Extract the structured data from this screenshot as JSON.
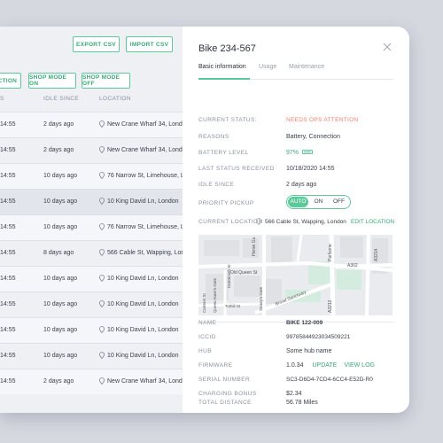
{
  "toolbar": {
    "export_csv": "EXPORT CSV",
    "import_csv": "IMPORT CSV",
    "ection": "ECTION",
    "shop_mode_on": "SHOP MODE ON",
    "shop_mode_off": "SHOP MODE OFF"
  },
  "table": {
    "columns": {
      "time": "S",
      "idle": "IDLE SINCE",
      "location": "LOCATION"
    },
    "rows": [
      {
        "time": "14:55",
        "idle": "2 days ago",
        "location": "New Crane Wharf 34, London"
      },
      {
        "time": "14:55",
        "idle": "2 days ago",
        "location": "New Crane Wharf 34, London"
      },
      {
        "time": "14:55",
        "idle": "10 days ago",
        "location": "76 Narrow St, Limehouse, London"
      },
      {
        "time": "14:55",
        "idle": "10 days ago",
        "location": "10 King David Ln, London"
      },
      {
        "time": "14:55",
        "idle": "10 days ago",
        "location": "76 Narrow St, Limehouse, London"
      },
      {
        "time": "14:55",
        "idle": "8 days ago",
        "location": "566 Cable St, Wapping, London"
      },
      {
        "time": "14:55",
        "idle": "10 days ago",
        "location": "10 King David Ln, London"
      },
      {
        "time": "14:55",
        "idle": "10 days ago",
        "location": "10 King David Ln, London"
      },
      {
        "time": "14:55",
        "idle": "10 days ago",
        "location": "10 King David Ln, London"
      },
      {
        "time": "14:55",
        "idle": "10 days ago",
        "location": "10 King David Ln, London"
      },
      {
        "time": "14:55",
        "idle": "2 days ago",
        "location": "New Crane Wharf 34, London"
      }
    ]
  },
  "detail": {
    "title": "Bike 234-567",
    "tabs": [
      "Basic information",
      "Usage",
      "Maintenance"
    ],
    "current_status_label": "CURRENT STATUS:",
    "current_status": "NEEDS OPS ATTENTION",
    "reasons_label": "REASONS",
    "reasons": "Battery, Connection",
    "battery_label": "BATTERY LEVEL",
    "battery": "97%",
    "last_status_label": "LAST STATUS RECEIVED",
    "last_status": "10/18/2020 14:55",
    "idle_since_label": "IDLE SINCE",
    "idle_since": "2 days ago",
    "priority_label": "PRIORITY PICKUP",
    "priority_options": [
      "AUTO",
      "ON",
      "OFF"
    ],
    "location_label": "CURRENT LOCATION",
    "location": "566 Cable St, Wapping, London",
    "edit_location": "EDIT LOCATION",
    "map_labels": {
      "old_queen": "Old Queen St",
      "horse_guards": "Horse Gu",
      "parliament": "Parliame",
      "a302": "A302",
      "a3212": "A3212",
      "a3214": "A3214",
      "broad_sanctuary": "Broad Sanctuary",
      "carteret": "Carteret St",
      "tothill": "Tothill St",
      "queen_annes": "Queen Anne's Gate",
      "dartmouth": "Dartmouth St",
      "storeys": "Storey's Gate"
    },
    "name_label": "NAME",
    "name": "BIKE 122-009",
    "iccid_label": "ICCID",
    "iccid": "99785844923034509221",
    "hub_label": "HUB",
    "hub": "Some hub name",
    "firmware_label": "FIRMWARE",
    "firmware": "1.0.34",
    "update": "UPDATE",
    "view_log": "VIEW LOG",
    "serial_label": "SERIAL NUMBER",
    "serial": "SC3-D6D4-7CD4-6CC4-E52D-R0",
    "charging_label": "CHARGING BONUS",
    "charging": "$2.34",
    "distance_label": "TOTAL DISTANCE",
    "distance": "56.78 Miles"
  },
  "colors": {
    "accent": "#5cc99a",
    "alert": "#ef7d70"
  }
}
